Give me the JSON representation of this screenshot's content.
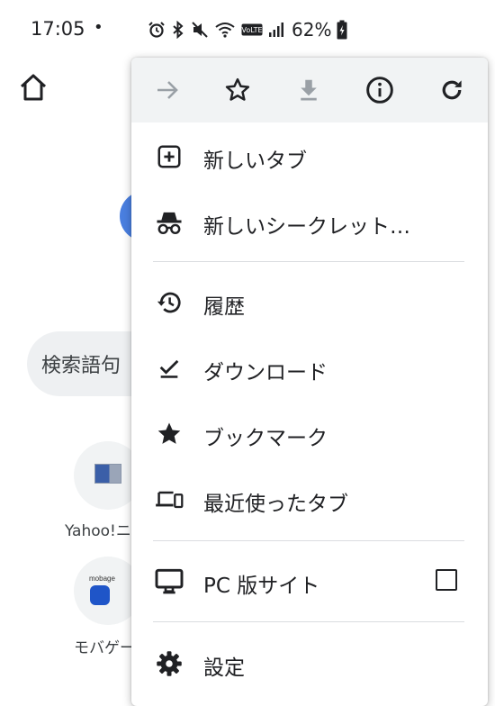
{
  "status_bar": {
    "time": "17:05",
    "dot": "•",
    "battery_percent": "62%",
    "icons": [
      "alarm-icon",
      "bluetooth-icon",
      "mute-icon",
      "wifi-icon",
      "volte-icon",
      "signal-icon",
      "battery-charging-icon"
    ]
  },
  "background": {
    "search_placeholder": "検索語句",
    "tiles": [
      {
        "label": "Yahoo!ニ",
        "icon": "yahoo-news-icon"
      },
      {
        "label": "モバゲー",
        "icon": "mobage-icon",
        "logo_text": "mobage"
      }
    ]
  },
  "menu": {
    "toolbar": [
      "forward-icon",
      "bookmark-star-icon",
      "download-icon",
      "info-icon",
      "reload-icon"
    ],
    "items": [
      {
        "label": "新しいタブ",
        "icon": "new-tab-icon"
      },
      {
        "label": "新しいシークレット…",
        "icon": "incognito-icon"
      },
      {
        "label": "履歴",
        "icon": "history-icon"
      },
      {
        "label": "ダウンロード",
        "icon": "downloads-icon"
      },
      {
        "label": "ブックマーク",
        "icon": "bookmarks-icon"
      },
      {
        "label": "最近使ったタブ",
        "icon": "recent-tabs-icon"
      },
      {
        "label": "PC 版サイト",
        "icon": "desktop-icon",
        "checked": false
      },
      {
        "label": "設定",
        "icon": "settings-icon"
      }
    ]
  },
  "colors": {
    "menu_toolbar_bg": "#f1f3f4",
    "disabled_icon": "#9aa0a6",
    "text": "#202124",
    "divider": "#dadce0"
  }
}
